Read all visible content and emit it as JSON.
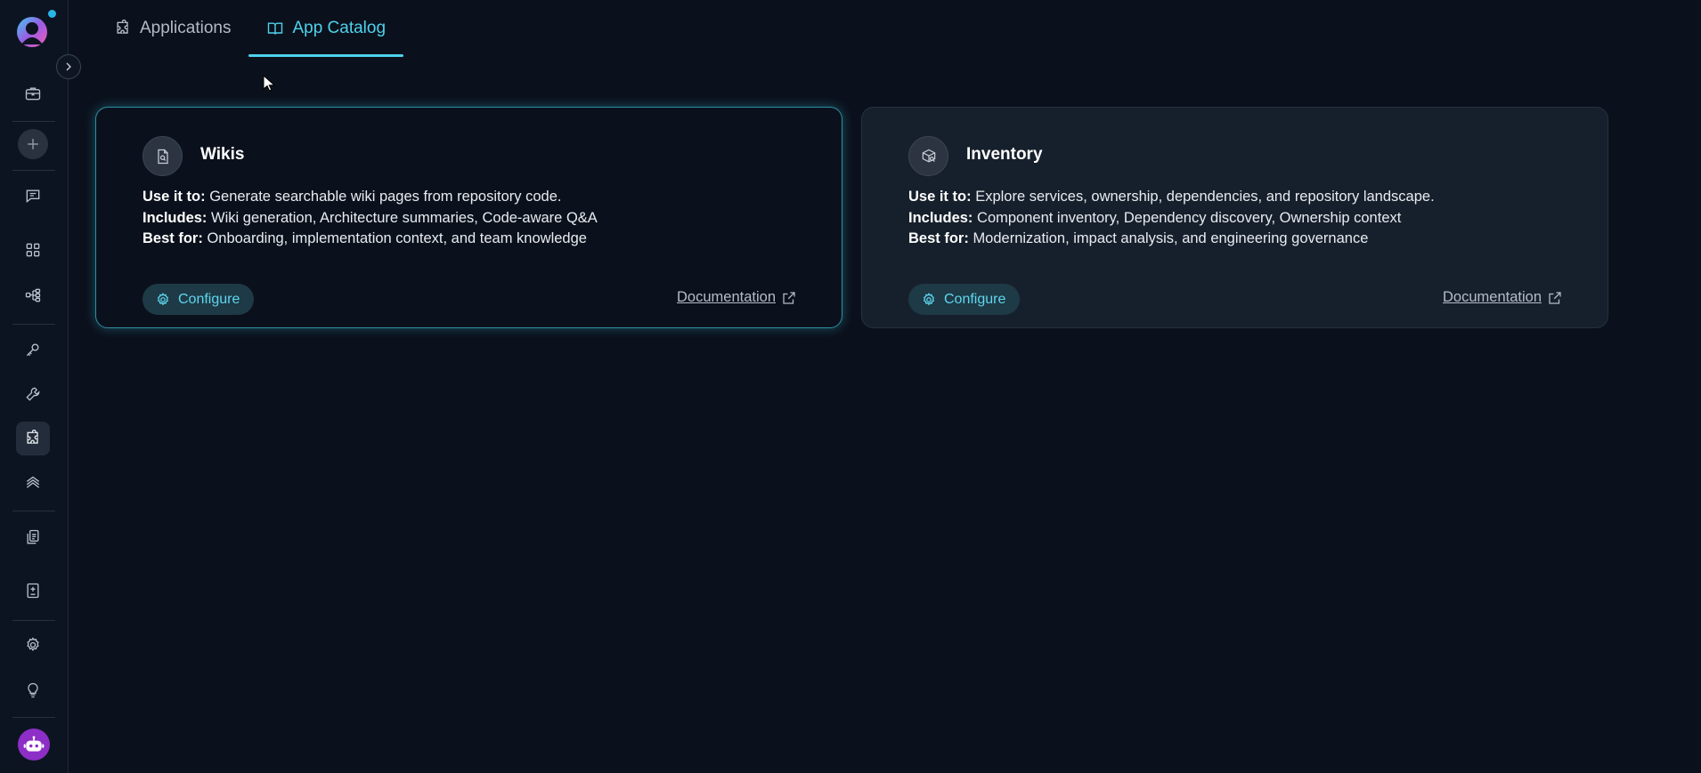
{
  "tabs": [
    {
      "label": "Applications",
      "icon": "puzzle-icon",
      "active": false
    },
    {
      "label": "App Catalog",
      "icon": "book-open-icon",
      "active": true
    }
  ],
  "sidebar": {
    "items": [
      {
        "name": "briefcase-icon"
      },
      {
        "name": "plus-icon"
      },
      {
        "name": "chat-icon"
      },
      {
        "name": "grid-icon"
      },
      {
        "name": "flow-icon"
      },
      {
        "name": "key-icon"
      },
      {
        "name": "wrench-icon"
      },
      {
        "name": "puzzle-icon",
        "active": true
      },
      {
        "name": "stack-icon"
      },
      {
        "name": "documents-icon"
      },
      {
        "name": "medical-report-icon"
      },
      {
        "name": "gear-icon"
      },
      {
        "name": "lightbulb-icon"
      }
    ]
  },
  "cards": [
    {
      "title": "Wikis",
      "icon": "document-search-icon",
      "use_label": "Use it to:",
      "use_text": "Generate searchable wiki pages from repository code.",
      "includes_label": "Includes:",
      "includes_text": "Wiki generation, Architecture summaries, Code-aware Q&A",
      "best_label": "Best for:",
      "best_text": "Onboarding, implementation context, and team knowledge",
      "configure_label": "Configure",
      "doc_label": "Documentation"
    },
    {
      "title": "Inventory",
      "icon": "box-search-icon",
      "use_label": "Use it to:",
      "use_text": "Explore services, ownership, dependencies, and repository landscape.",
      "includes_label": "Includes:",
      "includes_text": "Component inventory, Dependency discovery, Ownership context",
      "best_label": "Best for:",
      "best_text": "Modernization, impact analysis, and engineering governance",
      "configure_label": "Configure",
      "doc_label": "Documentation"
    }
  ],
  "colors": {
    "accent": "#4fd1ec",
    "background": "#0b111c",
    "avatar": "#8d2ec7"
  }
}
